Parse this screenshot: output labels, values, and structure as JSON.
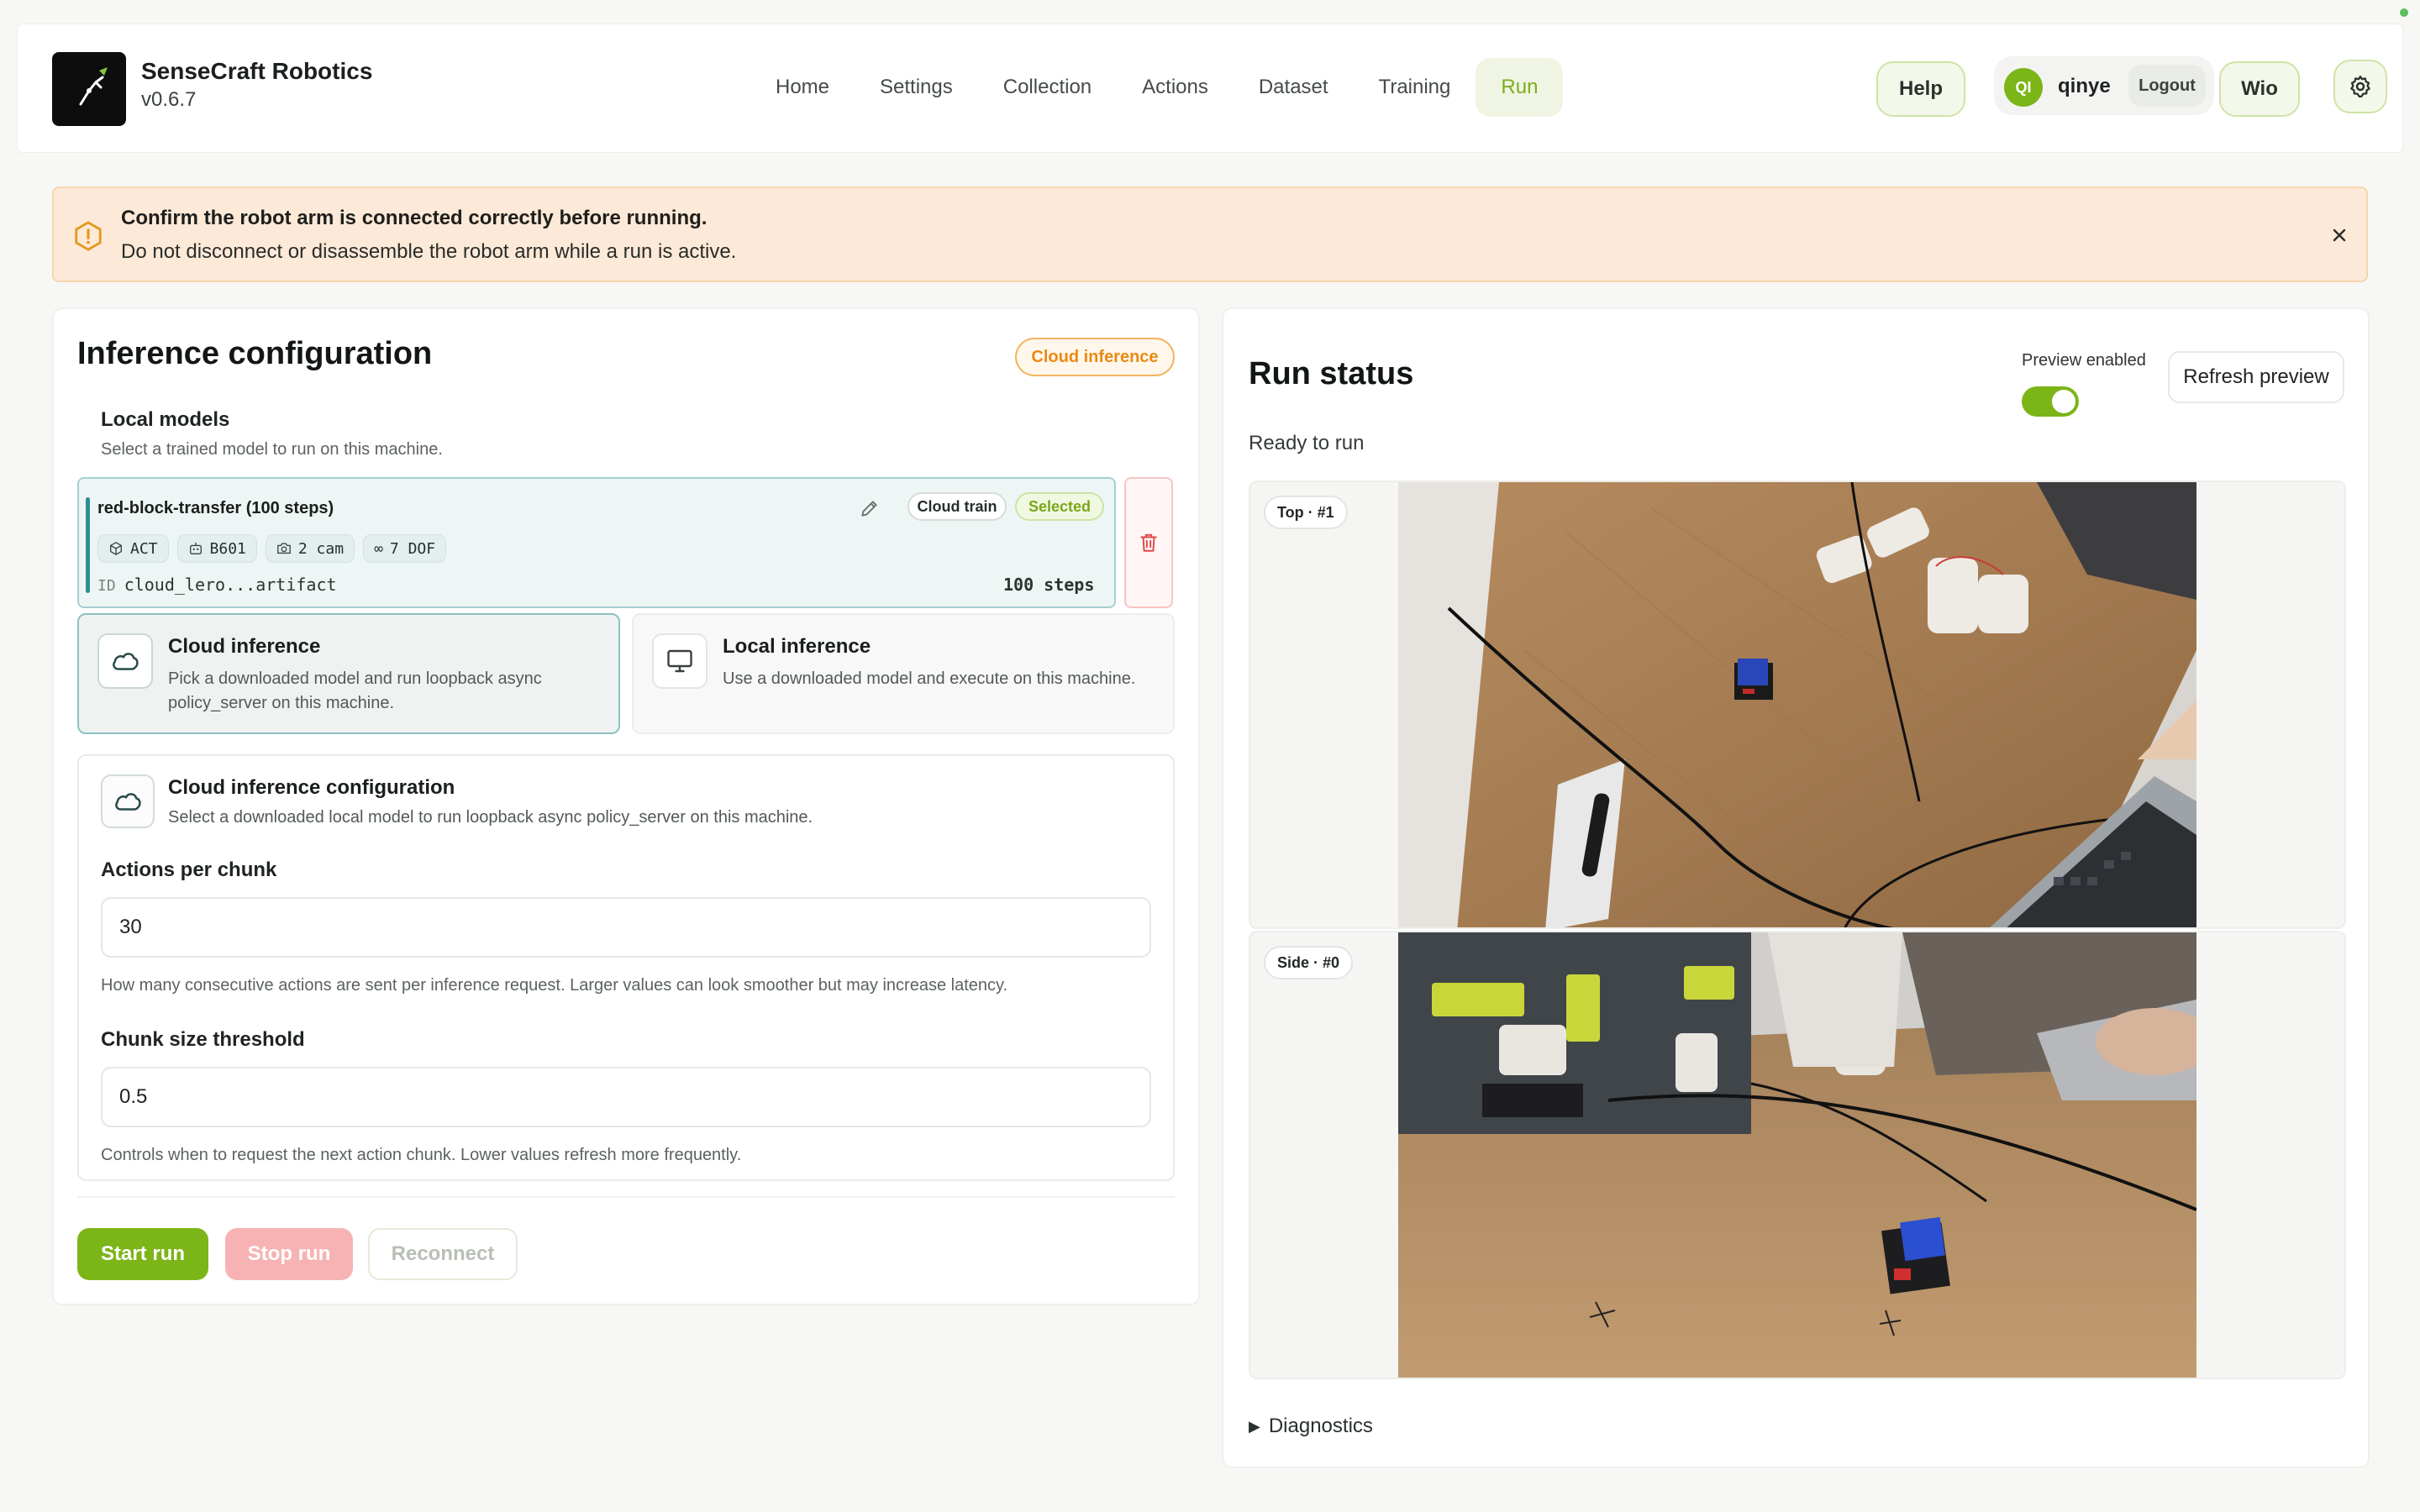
{
  "app": {
    "name": "SenseCraft Robotics",
    "version": "v0.6.7"
  },
  "nav": {
    "items": [
      "Home",
      "Settings",
      "Collection",
      "Actions",
      "Dataset",
      "Training",
      "Run"
    ],
    "active": "Run"
  },
  "header_actions": {
    "help_label": "Help",
    "user_initials": "QI",
    "username": "qinye",
    "logout_label": "Logout",
    "wio_label": "Wio",
    "settings_icon": "gear-icon"
  },
  "alert": {
    "icon": "warning-icon",
    "title": "Confirm the robot arm is connected correctly before running.",
    "body": "Do not disconnect or disassemble the robot arm while a run is active.",
    "close_icon": "close-icon"
  },
  "inference": {
    "title": "Inference configuration",
    "mode_chip": "Cloud inference",
    "local_models_heading": "Local models",
    "local_models_desc": "Select a trained model to run on this machine.",
    "model": {
      "name": "red-block-transfer (100 steps)",
      "tags": [
        "Cloud train",
        "Selected"
      ],
      "specs": [
        {
          "icon": "policy-icon",
          "label": "ACT"
        },
        {
          "icon": "robot-icon",
          "label": "B601"
        },
        {
          "icon": "camera-icon",
          "label": "2 cam"
        },
        {
          "icon": "infinity-icon",
          "label": "7 DOF"
        }
      ],
      "id_label": "ID",
      "id_value": "cloud_lero...artifact",
      "steps": "100 steps"
    },
    "modes": [
      {
        "icon": "cloud-icon",
        "title": "Cloud inference",
        "desc": "Pick a downloaded model and run loopback async policy_server on this machine.",
        "selected": true
      },
      {
        "icon": "monitor-icon",
        "title": "Local inference",
        "desc": "Use a downloaded model and execute on this machine.",
        "selected": false
      }
    ],
    "config": {
      "title": "Cloud inference configuration",
      "desc": "Select a downloaded local model to run loopback async policy_server on this machine.",
      "actions_per_chunk": {
        "label": "Actions per chunk",
        "value": "30",
        "help": "How many consecutive actions are sent per inference request. Larger values can look smoother but may increase latency."
      },
      "chunk_threshold": {
        "label": "Chunk size threshold",
        "value": "0.5",
        "help": "Controls when to request the next action chunk. Lower values refresh more frequently."
      }
    },
    "buttons": {
      "start": "Start run",
      "stop": "Stop run",
      "reconnect": "Reconnect"
    }
  },
  "run_status": {
    "title": "Run status",
    "preview_label": "Preview enabled",
    "preview_enabled": true,
    "refresh_label": "Refresh preview",
    "status_text": "Ready to run",
    "cameras": [
      {
        "label": "Top · #1"
      },
      {
        "label": "Side · #0"
      }
    ],
    "diagnostics_label": "Diagnostics"
  },
  "colors": {
    "accent_green": "#7cb518",
    "alert_bg": "#fde9d7",
    "cloud_orange": "#ea8a12",
    "teal_selected": "#2d8f93",
    "danger_red": "#e04848"
  }
}
